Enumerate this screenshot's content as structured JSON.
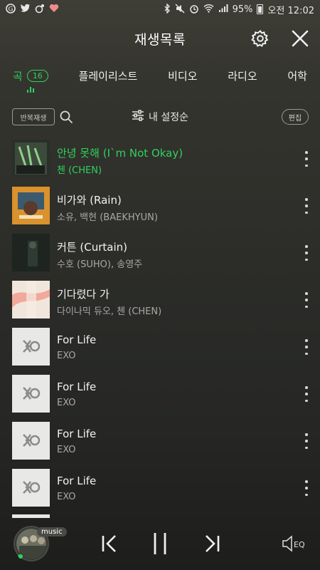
{
  "status": {
    "battery_percent": "95%",
    "time_label": "오전 12:02"
  },
  "header": {
    "title": "재생목록"
  },
  "tabs": [
    {
      "label": "곡",
      "count": "16",
      "active": true
    },
    {
      "label": "플레이리스트"
    },
    {
      "label": "비디오"
    },
    {
      "label": "라디오"
    },
    {
      "label": "어학"
    }
  ],
  "toolbar": {
    "repeat_label": "반복재생",
    "sort_label": "내 설정순",
    "edit_label": "편집"
  },
  "tracks": [
    {
      "title": "안녕 못해 (I`m Not Okay)",
      "artist": "첸 (CHEN)",
      "playing": true
    },
    {
      "title": "비가와 (Rain)",
      "artist": "소유, 백현 (BAEKHYUN)"
    },
    {
      "title": "커튼 (Curtain)",
      "artist": "수호 (SUHO), 송영주"
    },
    {
      "title": "기다렸다 가",
      "artist": "다이나믹 듀오, 첸 (CHEN)"
    },
    {
      "title": "For Life",
      "artist": "EXO"
    },
    {
      "title": "For Life",
      "artist": "EXO"
    },
    {
      "title": "For Life",
      "artist": "EXO"
    },
    {
      "title": "For Life",
      "artist": "EXO"
    }
  ],
  "player": {
    "music_badge": "music",
    "eq_label": "EQ"
  },
  "colors": {
    "accent": "#2fd15d"
  },
  "icons": [
    "settings-gear-icon",
    "close-icon",
    "search-icon",
    "sort-sliders-icon",
    "more-vertical-icon",
    "previous-track-icon",
    "pause-icon",
    "next-track-icon",
    "eq-speaker-icon"
  ]
}
